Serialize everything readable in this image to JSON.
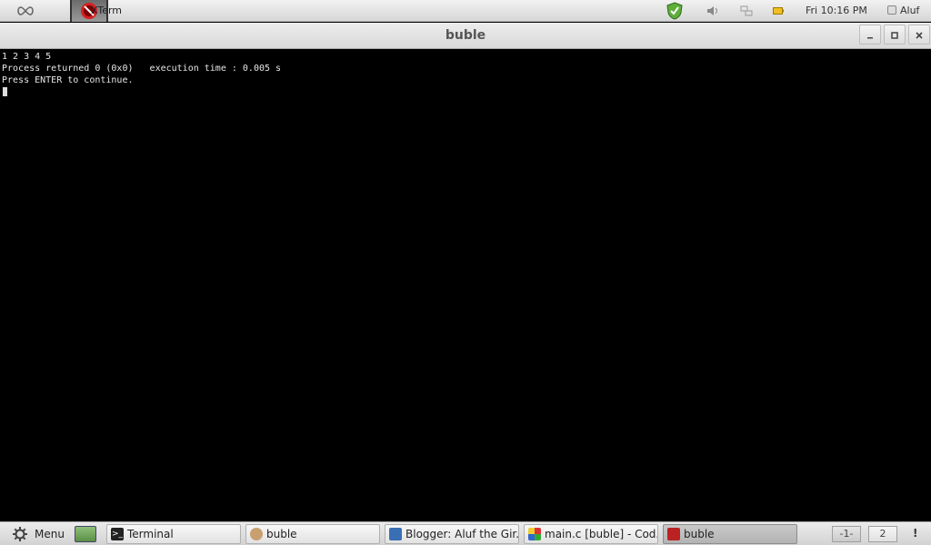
{
  "top_panel": {
    "active_app_label": "XTerm",
    "clock": "Fri 10:16 PM",
    "user": "Aluf"
  },
  "window": {
    "title": "buble"
  },
  "terminal": {
    "lines": [
      "1 2 3 4 5",
      "Process returned 0 (0x0)   execution time : 0.005 s",
      "Press ENTER to continue."
    ]
  },
  "taskbar": {
    "menu_label": "Menu",
    "tasks": [
      {
        "label": "Terminal"
      },
      {
        "label": "buble"
      },
      {
        "label": "Blogger: Aluf the Gir..."
      },
      {
        "label": "main.c [buble] - Cod..."
      },
      {
        "label": "buble"
      }
    ],
    "workspaces": [
      "-1-",
      "2"
    ],
    "notification": "!"
  },
  "colors": {
    "terminal_bg": "#000000",
    "terminal_fg": "#e6e6e6"
  }
}
